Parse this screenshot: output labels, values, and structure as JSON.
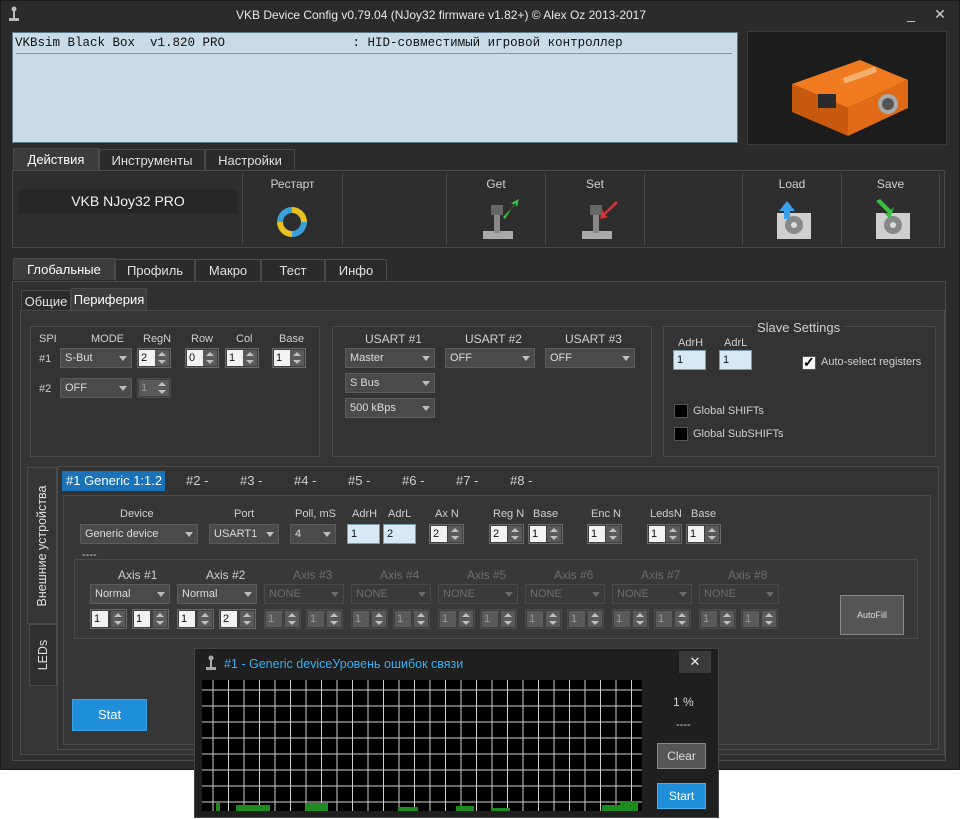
{
  "window": {
    "title": "VKB Device Config v0.79.04 (NJoy32 firmware v1.82+) © Alex Oz 2013-2017",
    "minimize": "_",
    "close": "✕"
  },
  "info_text": "VKBsim Black Box  v1.820 PRO                 : HID-совместимый игровой контроллер",
  "top_tabs": [
    "Действия",
    "Инструменты",
    "Настройки"
  ],
  "toolbar": {
    "device_name": "VKB NJoy32 PRO",
    "restart": "Рестарт",
    "get": "Get",
    "set": "Set",
    "load": "Load",
    "save": "Save"
  },
  "main_tabs": [
    "Глобальные",
    "Профиль",
    "Макро",
    "Тест",
    "Инфо"
  ],
  "sub_tabs": [
    "Общие",
    "Периферия"
  ],
  "spi": {
    "title": "SPI",
    "headers": [
      "MODE",
      "RegN",
      "Row",
      "Col",
      "Base"
    ],
    "row1_label": "#1",
    "row2_label": "#2",
    "row1_mode": "S-But",
    "row1_regn": "2",
    "row1_row": "0",
    "row1_col": "1",
    "row1_base": "1",
    "row2_mode": "OFF",
    "row2_regn": "1"
  },
  "usart": {
    "headers": [
      "USART #1",
      "USART #2",
      "USART #3"
    ],
    "u1_mode": "Master",
    "u1_bus": "S Bus",
    "u1_speed": "500 kBps",
    "u2_mode": "OFF",
    "u3_mode": "OFF"
  },
  "slave": {
    "title": "Slave Settings",
    "adrh_label": "AdrH",
    "adrl_label": "AdrL",
    "adrh": "1",
    "adrl": "1",
    "auto_select": "Auto-select registers",
    "global_shifts": "Global SHIFTs",
    "global_subshifts": "Global SubSHIFTs"
  },
  "side_tabs": [
    "Внешние устройства",
    "LEDs"
  ],
  "device_tabs": [
    "#1 Generic 1:1.2",
    "#2 -",
    "#3 -",
    "#4 -",
    "#5 -",
    "#6 -",
    "#7 -",
    "#8 -"
  ],
  "device": {
    "labels": {
      "device": "Device",
      "port": "Port",
      "poll": "Poll, mS",
      "adrh": "AdrH",
      "adrl": "AdrL",
      "axn": "Ax N",
      "regn": "Reg N",
      "base": "Base",
      "encn": "Enc N",
      "ledsn": "LedsN",
      "base2": "Base"
    },
    "device_value": "Generic device",
    "port_value": "USART1",
    "poll_value": "4",
    "adrh_value": "1",
    "adrl_value": "2",
    "axn_value": "2",
    "regn_value": "2",
    "base_value": "1",
    "encn_value": "1",
    "ledsn_value": "1",
    "base2_value": "1",
    "separator": "----"
  },
  "axes": {
    "labels": [
      "Axis #1",
      "Axis #2",
      "Axis #3",
      "Axis #4",
      "Axis #5",
      "Axis #6",
      "Axis #7",
      "Axis #8"
    ],
    "modes": [
      "Normal",
      "Normal",
      "NONE",
      "NONE",
      "NONE",
      "NONE",
      "NONE",
      "NONE"
    ],
    "left_vals": [
      "1",
      "1",
      "1",
      "1",
      "1",
      "1",
      "1",
      "1"
    ],
    "right_vals": [
      "1",
      "2",
      "1",
      "1",
      "1",
      "1",
      "1",
      "1"
    ],
    "autofill": "AutoFill"
  },
  "stat_button": "Stat",
  "popup": {
    "title": "#1 - Generic deviceУровень ошибок связи",
    "close": "✕",
    "percent": "1 %",
    "dashes": "----",
    "clear": "Clear",
    "start": "Start"
  },
  "colors": {
    "accent": "#1e8fd8",
    "window_bg": "#2b2b2b",
    "info_bg": "#c8dbe6",
    "graph_bar": "#1f8a1f"
  }
}
